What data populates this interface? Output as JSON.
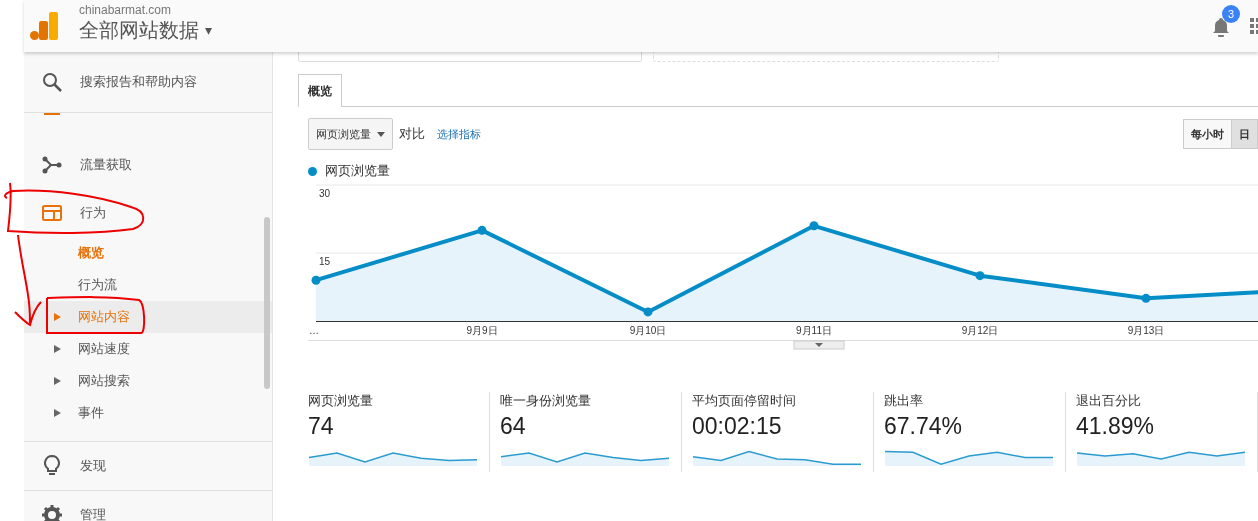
{
  "header": {
    "account": "chinabarmat.com",
    "property": "全部网站数据",
    "caret": "▾",
    "notifications": "3"
  },
  "sidebar": {
    "search": "搜索报告和帮助内容",
    "items": [
      {
        "kind": "audience"
      },
      {
        "kind": "acquisition",
        "label": "流量获取"
      },
      {
        "kind": "behavior",
        "label": "行为",
        "children": [
          {
            "label": "概览",
            "selected": true,
            "expandable": false,
            "highlighted": false
          },
          {
            "label": "行为流",
            "selected": false,
            "expandable": false,
            "highlighted": false
          },
          {
            "label": "网站内容",
            "selected": false,
            "expandable": true,
            "highlighted": true
          },
          {
            "label": "网站速度",
            "selected": false,
            "expandable": true,
            "highlighted": false
          },
          {
            "label": "网站搜索",
            "selected": false,
            "expandable": true,
            "highlighted": false
          },
          {
            "label": "事件",
            "selected": false,
            "expandable": true,
            "highlighted": false
          }
        ]
      }
    ],
    "bottom": [
      {
        "kind": "discover",
        "label": "发现"
      },
      {
        "kind": "admin",
        "label": "管理"
      }
    ]
  },
  "tabs": [
    {
      "label": "概览",
      "selected": true
    }
  ],
  "controls": {
    "metric": "网页浏览量",
    "compare": "对比",
    "choose_metric": "选择指标",
    "granularity": [
      {
        "label": "每小时",
        "selected": false
      },
      {
        "label": "日",
        "selected": true
      }
    ]
  },
  "chart": {
    "chart_data": {
      "type": "area",
      "categories": [
        "…",
        "9月9日",
        "9月10日",
        "9月11日",
        "9月12日",
        "9月13日",
        null
      ],
      "series": [
        {
          "name": "网页浏览量",
          "color": "#058dc7",
          "values": [
            9,
            20,
            2,
            21,
            10,
            5,
            7
          ]
        }
      ],
      "ylim": [
        0,
        30
      ],
      "yticks": [
        15,
        30
      ]
    }
  },
  "scorecards": [
    {
      "label": "网页浏览量",
      "value": "74"
    },
    {
      "label": "唯一身份浏览量",
      "value": "64"
    },
    {
      "label": "平均页面停留时间",
      "value": "00:02:15"
    },
    {
      "label": "跳出率",
      "value": "67.74%"
    },
    {
      "label": "退出百分比",
      "value": "41.89%"
    }
  ]
}
